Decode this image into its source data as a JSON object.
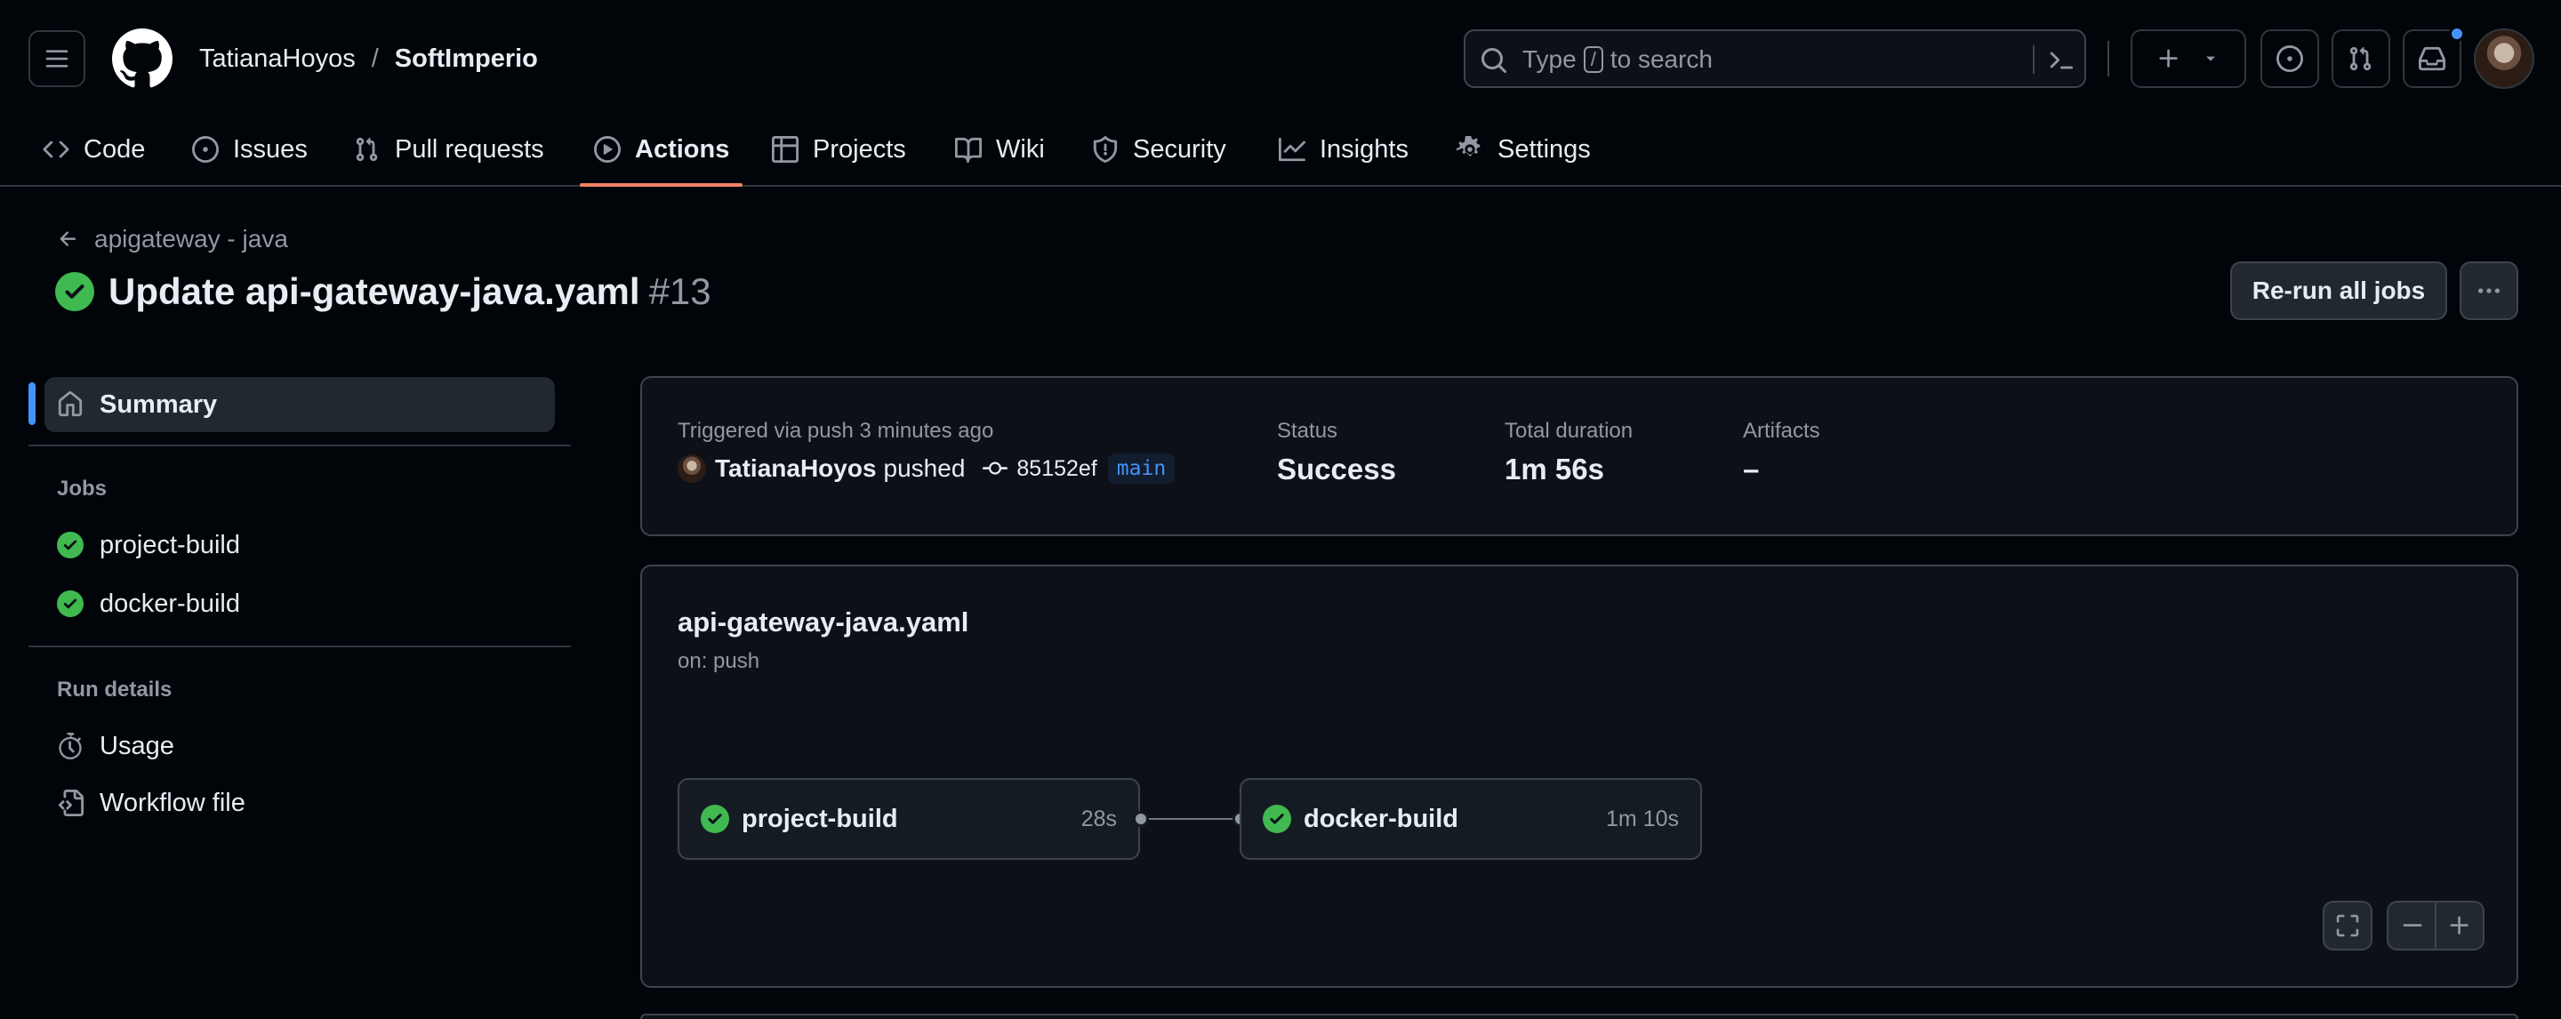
{
  "header": {
    "owner": "TatianaHoyos",
    "separator": "/",
    "repo": "SoftImperio",
    "search": {
      "prefix": "Type",
      "key": "/",
      "suffix": "to search"
    }
  },
  "repo_nav": {
    "items": [
      {
        "label": "Code",
        "icon": "code-icon"
      },
      {
        "label": "Issues",
        "icon": "issue-icon"
      },
      {
        "label": "Pull requests",
        "icon": "pull-request-icon"
      },
      {
        "label": "Actions",
        "icon": "play-icon",
        "active": true
      },
      {
        "label": "Projects",
        "icon": "table-icon"
      },
      {
        "label": "Wiki",
        "icon": "book-icon"
      },
      {
        "label": "Security",
        "icon": "shield-icon"
      },
      {
        "label": "Insights",
        "icon": "graph-icon"
      },
      {
        "label": "Settings",
        "icon": "gear-icon"
      }
    ]
  },
  "run": {
    "back_label": "apigateway - java",
    "title": "Update api-gateway-java.yaml",
    "number": "#13",
    "rerun_label": "Re-run all jobs"
  },
  "sidebar": {
    "summary_label": "Summary",
    "jobs_heading": "Jobs",
    "jobs": [
      {
        "label": "project-build",
        "status": "success"
      },
      {
        "label": "docker-build",
        "status": "success"
      }
    ],
    "details_heading": "Run details",
    "details": [
      {
        "label": "Usage",
        "icon": "stopwatch-icon"
      },
      {
        "label": "Workflow file",
        "icon": "file-code-icon"
      }
    ]
  },
  "summary": {
    "trigger_label": "Triggered via push 3 minutes ago",
    "actor": "TatianaHoyos",
    "verb": "pushed",
    "commit_sha": "85152ef",
    "branch": "main",
    "status_label": "Status",
    "status_value": "Success",
    "duration_label": "Total duration",
    "duration_value": "1m 56s",
    "artifacts_label": "Artifacts",
    "artifacts_value": "–"
  },
  "workflow": {
    "name": "api-gateway-java.yaml",
    "trigger": "on: push",
    "jobs": [
      {
        "name": "project-build",
        "duration": "28s"
      },
      {
        "name": "docker-build",
        "duration": "1m 10s"
      }
    ]
  },
  "colors": {
    "success": "#3fb950",
    "accent_underline": "#f78166",
    "link_blue": "#4493f8"
  }
}
